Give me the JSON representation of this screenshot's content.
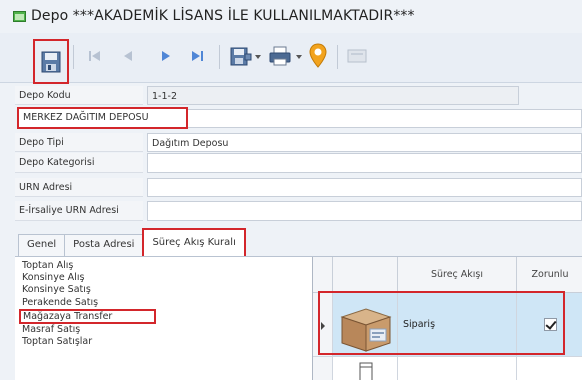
{
  "window": {
    "title": "Depo ***AKADEMİK LİSANS İLE KULLANILMAKTADIR***",
    "icon": "form-icon"
  },
  "toolbar": {
    "buttons": [
      "save-icon",
      "first-record-icon",
      "previous-record-icon",
      "next-record-icon",
      "last-record-icon",
      "save-options-icon",
      "print-icon",
      "location-pin-icon",
      "blank-button-icon"
    ]
  },
  "form": {
    "depo_kodu_label": "Depo Kodu",
    "depo_kodu_value": "1-1-2",
    "depo_adi_value": "MERKEZ DAĞITIM DEPOSU",
    "depo_tipi_label": "Depo Tipi",
    "depo_tipi_value": "Dağıtım Deposu",
    "depo_kategorisi_label": "Depo Kategorisi",
    "urn_adresi_label": "URN Adresi",
    "e_irsaliye_label": "E-İrsaliye URN Adresi"
  },
  "tabs": [
    "Genel",
    "Posta Adresi",
    "Süreç Akış Kuralı"
  ],
  "process_list": [
    "Toptan Alış",
    "Konsinye Alış",
    "Konsinye Satış",
    "Perakende Satış",
    "Mağazaya Transfer",
    "Masraf Satış",
    "Toptan Satışlar"
  ],
  "grid": {
    "col_surec_akisi": "Süreç Akışı",
    "col_zorunlu": "Zorunlu",
    "row1_label": "Sipariş",
    "row1_zorunlu": true
  },
  "colors": {
    "highlight": "#d3262b",
    "selected_row": "#cfe6f6"
  }
}
